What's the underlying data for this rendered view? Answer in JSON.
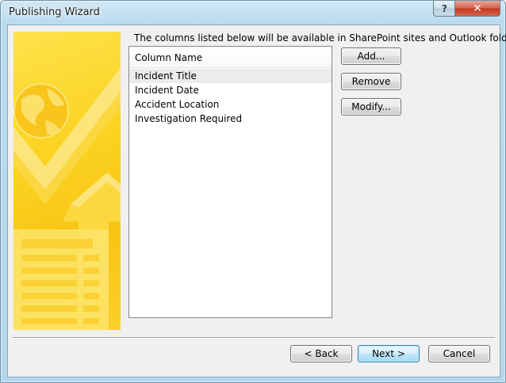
{
  "window": {
    "title": "Publishing Wizard",
    "help_glyph": "?",
    "close_glyph": "✕"
  },
  "main": {
    "intro_text": "The columns listed below will be available in SharePoint sites and Outlook folders.",
    "list": {
      "header": "Column Name",
      "items": [
        "Incident Title",
        "Incident Date",
        "Accident Location",
        "Investigation Required"
      ],
      "selected_index": 0
    },
    "side_buttons": {
      "add": "Add...",
      "remove": "Remove",
      "modify": "Modify..."
    }
  },
  "footer": {
    "back": "< Back",
    "next": "Next >",
    "cancel": "Cancel"
  },
  "colors": {
    "banner_yellow": "#fbd321",
    "banner_light": "#fde76b",
    "selected_row": "#ececec",
    "close_red": "#c8412a"
  },
  "icons": {
    "banner": "publishing-wizard-banner-illustration"
  }
}
